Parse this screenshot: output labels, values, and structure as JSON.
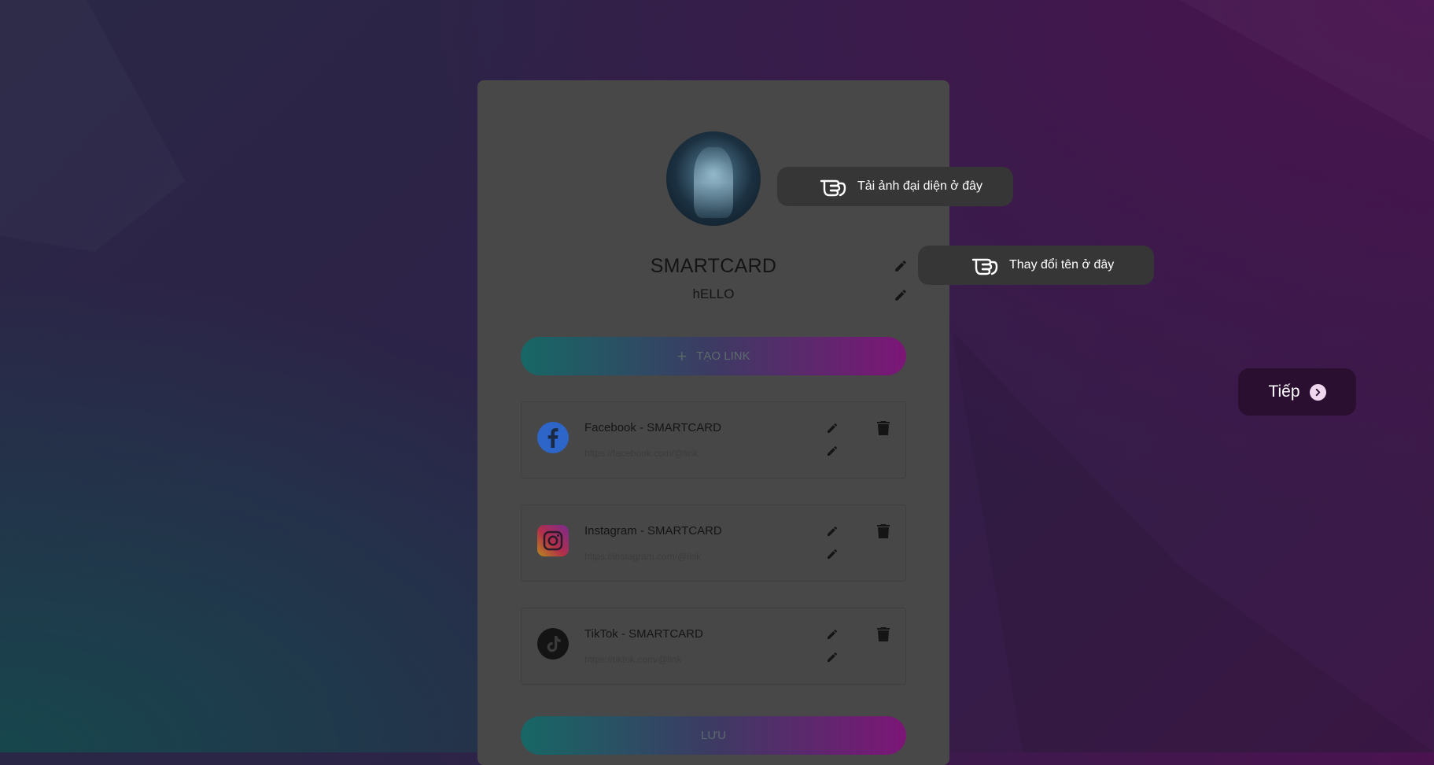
{
  "profile": {
    "name": "SMARTCARD",
    "bio": "hELLO"
  },
  "buttons": {
    "create_link_label": "TẠO LINK",
    "save_label": "LƯU",
    "next_label": "Tiếp"
  },
  "links": [
    {
      "title": "Facebook - SMARTCARD",
      "url": "https://facebook.com/@link",
      "icon": "facebook-icon"
    },
    {
      "title": "Instagram - SMARTCARD",
      "url": "https://instagram.com/@link",
      "icon": "instagram-icon"
    },
    {
      "title": "TikTok - SMARTCARD",
      "url": "https://tiktok.com/@link",
      "icon": "tiktok-icon"
    }
  ],
  "tooltips": {
    "avatar_hint": "Tải ảnh đại diện ở đây",
    "name_hint": "Thay đổi tên ở đây"
  },
  "colors": {
    "gradient_start": "#176765",
    "gradient_end": "#7c1677",
    "card_bg": "#484848",
    "tooltip_bg": "#363636",
    "next_bg": "#2a0f30"
  }
}
